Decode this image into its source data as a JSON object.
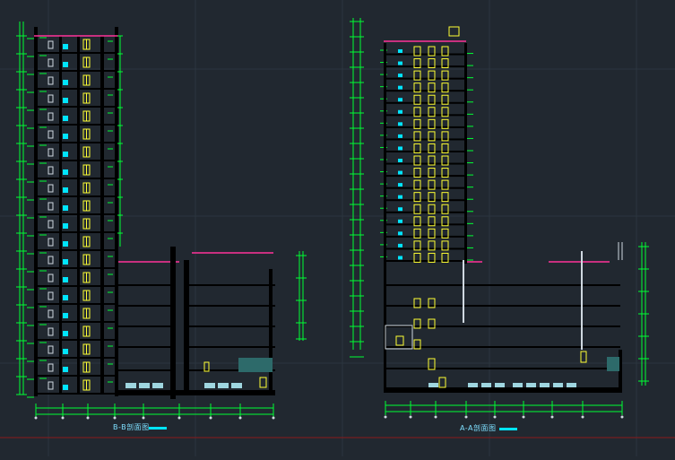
{
  "drawing": {
    "sections": [
      {
        "id": "bb",
        "title": "B-B剖面图",
        "floors_tower": 20,
        "floors_podium": 4
      },
      {
        "id": "aa",
        "title": "A-A剖面图",
        "floors_tower": 18,
        "floors_podium": 4
      }
    ],
    "colors": {
      "background": "#212830",
      "grid": "#2c353f",
      "wall": "#000000",
      "dimension": "#00ff33",
      "window": "#ffff33",
      "door": "#00e5ff",
      "accent": "#ff3399",
      "neutral": "#cfd8e0",
      "red_line": "#8c1a1a"
    }
  }
}
